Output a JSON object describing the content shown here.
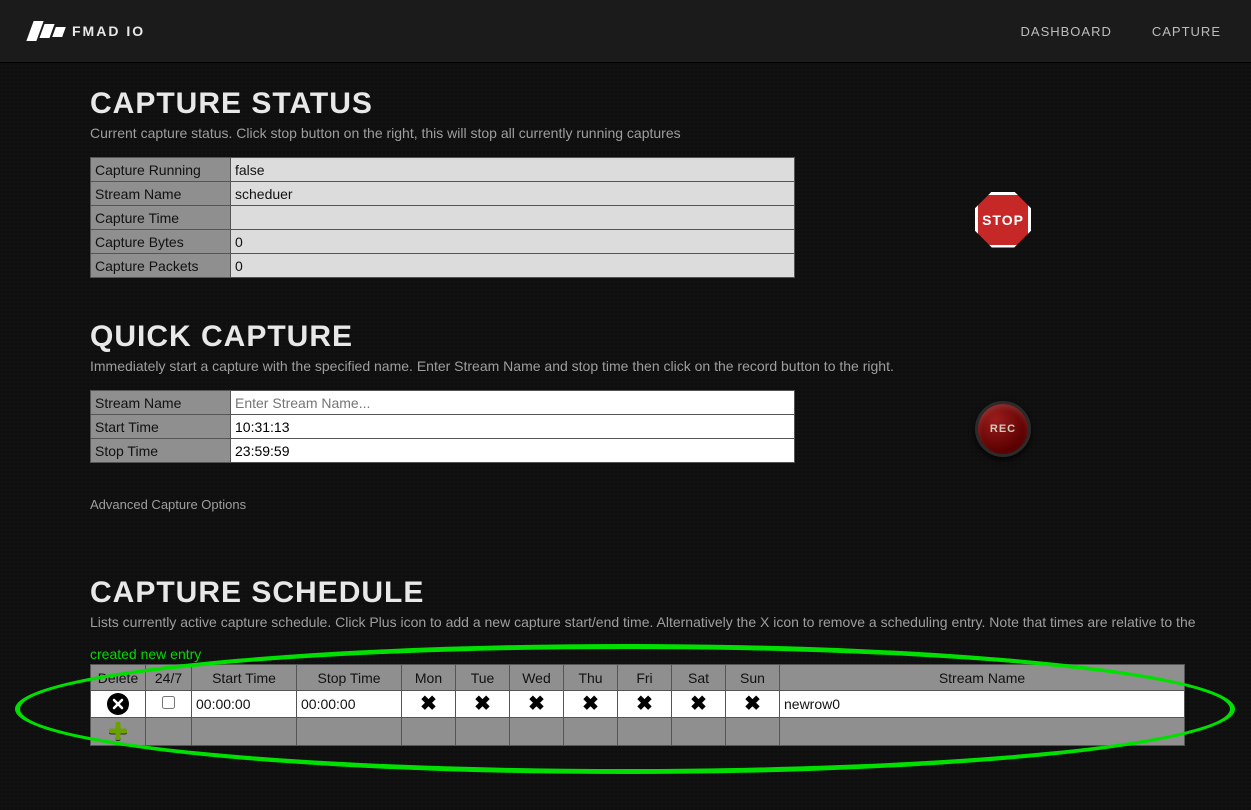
{
  "brand": "FMAD IO",
  "nav": {
    "dashboard": "DASHBOARD",
    "capture": "CAPTURE"
  },
  "status": {
    "title": "CAPTURE STATUS",
    "desc": "Current capture status. Click stop button on the right, this will stop all currently running captures",
    "rows": {
      "running_label": "Capture Running",
      "running_value": "false",
      "stream_label": "Stream Name",
      "stream_value": "scheduer",
      "time_label": "Capture Time",
      "time_value": "",
      "bytes_label": "Capture Bytes",
      "bytes_value": "0",
      "packets_label": "Capture Packets",
      "packets_value": "0"
    },
    "stop_label": "STOP"
  },
  "quick": {
    "title": "QUICK CAPTURE",
    "desc": "Immediately start a capture with the specified name. Enter Stream Name and stop time then click on the record button to the right.",
    "stream_label": "Stream Name",
    "stream_placeholder": "Enter Stream Name...",
    "start_label": "Start Time",
    "start_value": "10:31:13",
    "stop_label": "Stop Time",
    "stop_value": "23:59:59",
    "rec_label": "REC",
    "advanced": "Advanced Capture Options"
  },
  "schedule": {
    "title": "CAPTURE SCHEDULE",
    "desc": "Lists currently active capture schedule. Click Plus icon to add a new capture start/end time. Alternatively the X icon to remove a scheduling entry. Note that times are relative to the",
    "note": "created new entry",
    "headers": {
      "delete": "Delete",
      "allday": "24/7",
      "start": "Start Time",
      "stop": "Stop Time",
      "mon": "Mon",
      "tue": "Tue",
      "wed": "Wed",
      "thu": "Thu",
      "fri": "Fri",
      "sat": "Sat",
      "sun": "Sun",
      "stream": "Stream Name"
    },
    "row": {
      "start": "00:00:00",
      "stop": "00:00:00",
      "stream": "newrow0"
    }
  }
}
